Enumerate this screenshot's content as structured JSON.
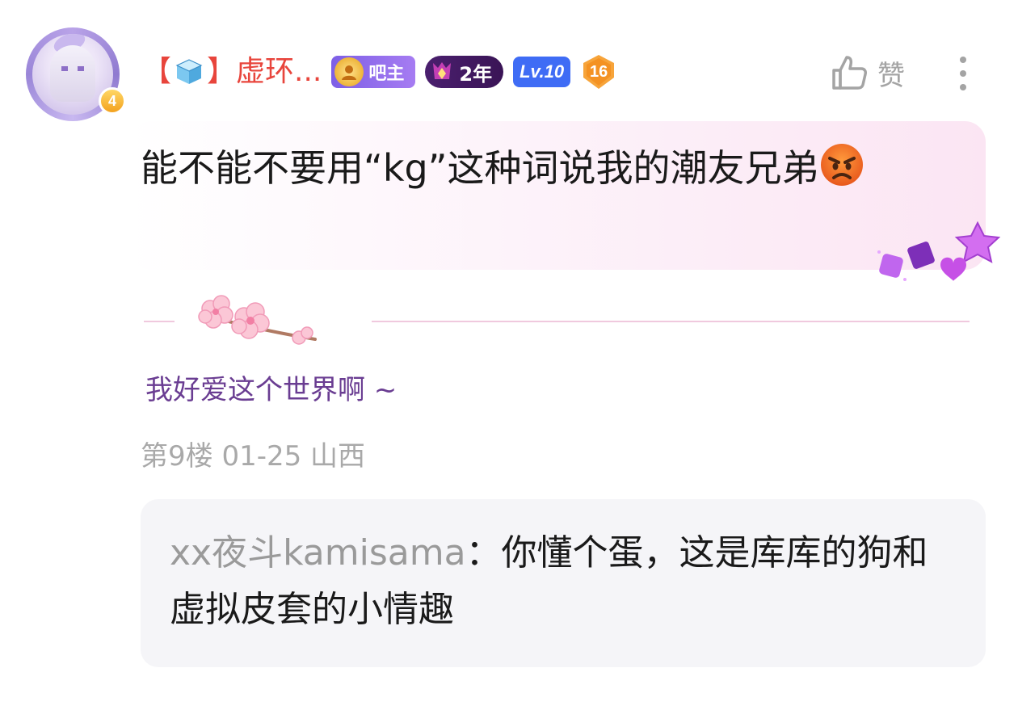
{
  "post": {
    "username_bracket_open": "【",
    "username_bracket_close": "】",
    "username_text": "虚环...",
    "avatar_level": "4",
    "badges": {
      "owner_label": "吧主",
      "years_label": "2年",
      "level_label": "Lv.10",
      "number_label": "16"
    },
    "like_label": "赞",
    "comment_text": "能不能不要用“kg”这种词说我的潮友兄弟",
    "signature": "我好爱这个世界啊 ~",
    "meta": "第9楼 01-25 山西"
  },
  "reply": {
    "user": "xx夜斗kamisama",
    "separator": "：",
    "text": "你懂个蛋，这是库库的狗和虚拟皮套的小情趣"
  },
  "colors": {
    "username": "#e8453c",
    "signature": "#6a3d92",
    "meta": "#a9a9a9",
    "reply_bg": "#f5f5f8",
    "badge_lv": "#3f6cf5"
  }
}
